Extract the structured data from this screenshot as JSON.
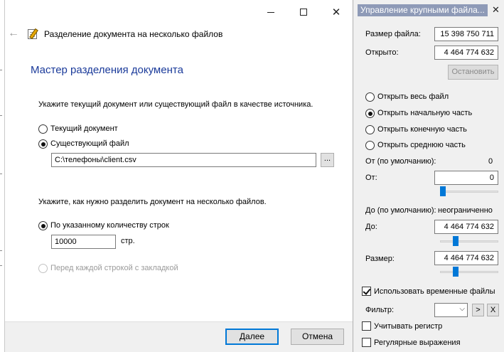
{
  "dialog": {
    "nav_title": "Разделение документа на несколько файлов",
    "heading": "Мастер разделения документа",
    "source_prompt": "Укажите текущий документ или существующий файл в качестве источника.",
    "source_options": [
      "Текущий документ",
      "Существующий файл"
    ],
    "file_path": "C:\\телефоны\\client.csv",
    "browse_label": "...",
    "split_prompt": "Укажите, как нужно разделить документ на несколько файлов.",
    "split_by_rows_label": "По указанному количеству строк",
    "rows_value": "10000",
    "rows_unit": "стр.",
    "split_by_bookmark_label": "Перед каждой строкой с закладкой",
    "ok_label": "Далее",
    "cancel_label": "Отмена"
  },
  "panel": {
    "title": "Управление крупными файла...",
    "close_icon": "close-icon",
    "file_size_label": "Размер файла:",
    "file_size_value": "15 398 750 711",
    "opened_label": "Открыто:",
    "opened_value": "4 464 774 632",
    "stop_label": "Остановить",
    "open_options": [
      "Открыть весь файл",
      "Открыть начальную часть",
      "Открыть конечную часть",
      "Открыть среднюю часть"
    ],
    "from_default_label": "От (по умолчанию):",
    "from_default_value": "0",
    "from_label": "От:",
    "from_value": "0",
    "to_default_label": "До (по умолчанию):",
    "to_default_value": "неограниченно",
    "to_label": "До:",
    "to_value": "4 464 774 632",
    "size_label": "Размер:",
    "size_value": "4 464 774 632",
    "temp_files_label": "Использовать временные файлы",
    "filter_label": "Фильтр:",
    "filter_apply_label": ">",
    "filter_clear_label": "X",
    "match_case_label": "Учитывать регистр",
    "regex_label": "Регулярные выражения"
  }
}
